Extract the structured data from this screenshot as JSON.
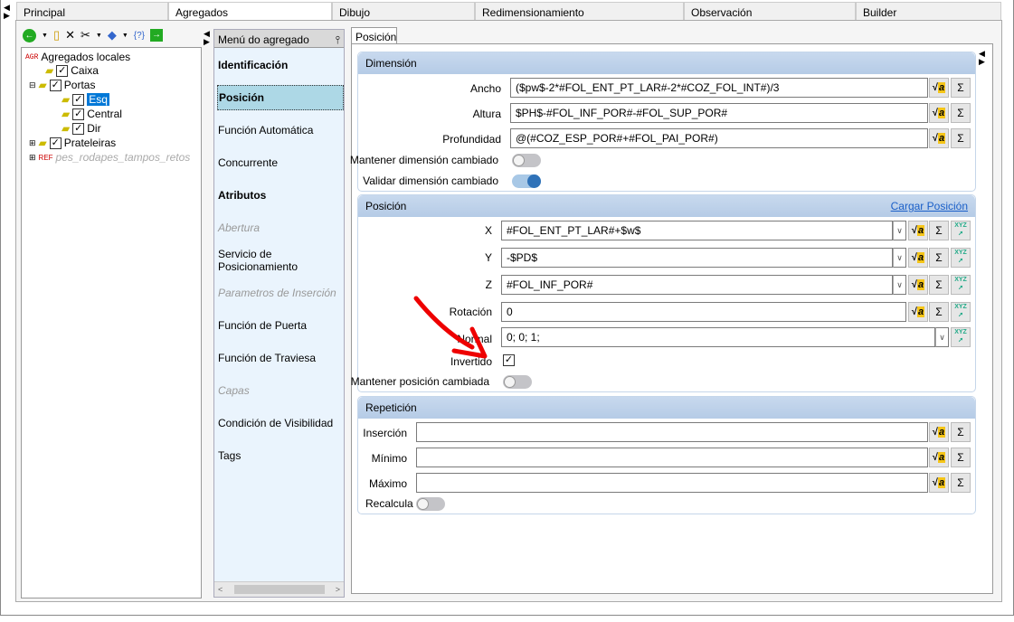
{
  "tabs": [
    "Principal",
    "Agregados",
    "Dibujo",
    "Redimensionamiento",
    "Observación",
    "Builder"
  ],
  "tree": {
    "root_badge": "AGR",
    "root": "Agregados locales",
    "items": [
      "Caixa",
      "Portas",
      "Esq",
      "Central",
      "Dir",
      "Prateleiras"
    ],
    "ref_badge": "REF",
    "ref": "pes_rodapes_tampos_retos"
  },
  "menu": {
    "title": "Menú do agregado",
    "items": [
      "Identificación",
      "Posición",
      "Función Automática",
      "Concurrente",
      "Atributos",
      "Abertura",
      "Servicio de Posicionamiento",
      "Parametros de Inserción",
      "Función de Puerta",
      "Función de Traviesa",
      "Capas",
      "Condición de Visibilidad",
      "Tags"
    ]
  },
  "right_tab": "Posición",
  "dimension": {
    "title": "Dimensión",
    "ancho_label": "Ancho",
    "ancho": "($pw$-2*#FOL_ENT_PT_LAR#-2*#COZ_FOL_INT#)/3",
    "altura_label": "Altura",
    "altura": "$PH$-#FOL_INF_POR#-#FOL_SUP_POR#",
    "prof_label": "Profundidad",
    "prof": "@(#COZ_ESP_POR#+#FOL_PAI_POR#)",
    "mantener": "Mantener dimensión cambiado",
    "validar": "Validar dimensión cambiado"
  },
  "posicion": {
    "title": "Posición",
    "link": "Cargar Posición",
    "x_label": "X",
    "x": "#FOL_ENT_PT_LAR#+$w$",
    "y_label": "Y",
    "y": "-$PD$",
    "z_label": "Z",
    "z": "#FOL_INF_POR#",
    "rot_label": "Rotación",
    "rot": "0",
    "normal_label": "Normal",
    "normal": "0; 0; 1;",
    "invertido": "Invertido",
    "mantener": "Mantener posición cambiada"
  },
  "repeticion": {
    "title": "Repetición",
    "insercion": "Inserción",
    "minimo": "Mínimo",
    "maximo": "Máximo",
    "recalcula": "Recalcula"
  },
  "icons": {
    "sqrt": "√",
    "sigma": "Σ",
    "xyz": "XYZ"
  }
}
